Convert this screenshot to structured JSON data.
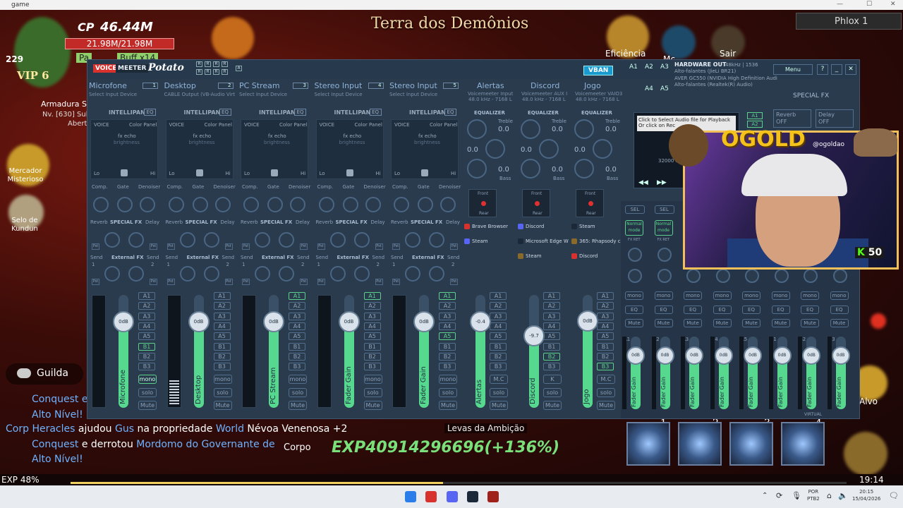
{
  "window": {
    "title": "game"
  },
  "game": {
    "level": "229",
    "vip": "VIP 6",
    "cp_label": "CP",
    "cp_value": "46.44M",
    "hp": "21.98M/21.98M",
    "pa": "Pa",
    "buff": "Buff x14",
    "armor_title": "Armadura Sa",
    "armor_sub": "Nv. [630] Sub",
    "armor_sub2": "Abert",
    "zone_title": "Terra dos Demônios",
    "top_buttons": [
      "Eficiência",
      "Mc",
      "Sair"
    ],
    "player_name": "Phlox 1",
    "left_menu": [
      "Mercador Misterioso",
      "Selo de Kundun"
    ],
    "guild_label": "Guilda",
    "chat_lines": [
      {
        "parts": [
          "Conquest e"
        ]
      },
      {
        "parts": [
          "Alto Nível!"
        ]
      },
      {
        "parts": [
          "Corp",
          "Heracles",
          "ajudou",
          "Gus",
          "na propriedade",
          "World",
          "Névoa Venenosa",
          "+2"
        ]
      },
      {
        "parts": [
          "Conquest",
          "e derrotou",
          "Mordomo do Governante de"
        ]
      },
      {
        "parts": [
          "Alto Nível!"
        ]
      }
    ],
    "corpo_label": "Corpo",
    "exp_big": "EXP40914296696(+136%)",
    "quest_text": "Levas da Ambição",
    "exp_percent": "EXP 48%",
    "clock": "19:14",
    "skill_numbers": [
      "1",
      "2",
      "3",
      "4"
    ],
    "alvo_label": "Alvo"
  },
  "voicemeeter": {
    "logo_voice": "VOICE",
    "logo_meeter": "MEETER",
    "logo_potato": "Potato",
    "vban_label": "VBAN",
    "hardware_out": {
      "title": "HARDWARE OUT",
      "spec": "48kHz | 1536",
      "devices": [
        "Alto-falantes (JieLi BR21)",
        "AVER GC550 (NVIDIA High Definition Audi",
        "Alto-falantes (Realtek(R) Audio)"
      ]
    },
    "a_buttons": [
      "A1",
      "A2",
      "A3",
      "A4",
      "A5"
    ],
    "menu_label": "Menu",
    "special_fx": "SPECIAL FX",
    "reverb_btn": [
      "Reverb",
      "OFF"
    ],
    "delay_btn": [
      "Delay",
      "OFF"
    ],
    "player_text": [
      "Click to Select Audio file for Playback",
      "Or click on Rec"
    ],
    "player_freq": "32000 Hz",
    "hardware_strips": [
      {
        "name": "Microfone",
        "sub": "Select Input Device",
        "num": "1",
        "fader_label": "Microfone",
        "fader_value": "0dB",
        "buses_on": [
          "B1"
        ],
        "mono_on": true
      },
      {
        "name": "Desktop",
        "sub": "CABLE Output (VB-Audio Virt",
        "num": "2",
        "fader_label": "Desktop",
        "fader_value": "0dB",
        "buses_on": [],
        "mono_on": false
      },
      {
        "name": "PC Stream",
        "sub": "Select Input Device",
        "num": "3",
        "fader_label": "PC Stream",
        "fader_value": "0dB",
        "buses_on": [
          "A1"
        ],
        "mono_on": false
      },
      {
        "name": "Stereo Input",
        "sub": "Select Input Device",
        "num": "4",
        "fader_label": "Fader Gain",
        "fader_value": "0dB",
        "buses_on": [
          "A1"
        ],
        "mono_on": false
      },
      {
        "name": "Stereo Input",
        "sub": "Select Input Device",
        "num": "5",
        "fader_label": "Fader Gain",
        "fader_value": "0dB",
        "buses_on": [
          "A1",
          "A5"
        ],
        "mono_on": false
      }
    ],
    "strip_labels": {
      "intellipan": "INTELLIPAN",
      "eq": "EQ",
      "voice": "VOICE",
      "color_panel": "Color Panel",
      "fx_echo": "fx echo",
      "brightness": "brightness",
      "lo": "Lo",
      "hi": "Hi",
      "comp": "Comp.",
      "gate": "Gate",
      "denoiser": "Denoiser",
      "reverb": "Reverb",
      "special_fx": "SPECIAL FX",
      "delay": "Delay",
      "send": "Send",
      "external_fx": "External FX",
      "send1": "1",
      "send2": "2",
      "pst": "Pst",
      "mono": "mono",
      "solo": "solo",
      "mute": "Mute",
      "bus_list": [
        "A1",
        "A2",
        "A3",
        "A4",
        "A5",
        "B1",
        "B2",
        "B3"
      ]
    },
    "virtual_strips": [
      {
        "name": "Alertas",
        "sub1": "Voicemeeter Input",
        "sub2": "48.0 kHz - 7168 L",
        "treble": "0.0",
        "mid": "0.0",
        "bass": "0.0",
        "fader_label": "Alertas",
        "fader_value": "-0.4",
        "apps": [
          "Brave Browser",
          "Steam"
        ],
        "buses_on": [],
        "level": -0.4
      },
      {
        "name": "Discord",
        "sub1": "Voicemeeter AUX I",
        "sub2": "48.0 kHz - 7168 L",
        "treble": "0.0",
        "mid": "0.0",
        "bass": "0.0",
        "fader_label": "Discord",
        "fader_value": "-9.7",
        "apps": [
          "Discord",
          "Microsoft Edge W",
          "Steam"
        ],
        "buses_on": [
          "B2"
        ],
        "level": -9.7
      },
      {
        "name": "Jogo",
        "sub1": "Voicemeeter VAIO3",
        "sub2": "48.0 kHz - 7168 L",
        "treble": "0.0",
        "mid": "0.0",
        "bass": "0.0",
        "fader_label": "Jogo",
        "fader_value": "0dB",
        "apps": [
          "Steam",
          "365: Rhapsody c",
          "Discord"
        ],
        "buses_on": [
          "B3"
        ],
        "level": 0
      }
    ],
    "virtual_labels": {
      "equalizer": "EQUALIZER",
      "treble": "Treble",
      "bass": "Bass",
      "front": "Front",
      "rear": "Rear",
      "mc": "M.C",
      "k": "K"
    },
    "output_buses": [
      {
        "name": "A1",
        "value": "0dB"
      },
      {
        "name": "A2",
        "value": "0dB"
      },
      {
        "name": "A3",
        "value": "0dB"
      },
      {
        "name": "A4",
        "value": "0dB"
      },
      {
        "name": "A5",
        "value": "0dB"
      },
      {
        "name": "B1",
        "value": "0dB"
      },
      {
        "name": "B2",
        "value": "0dB"
      },
      {
        "name": "B3",
        "value": "0dB"
      }
    ],
    "output_labels": {
      "sel": "SEL",
      "normal_mode": "Normal mode",
      "fx_ret": "FX RET",
      "mono": "mono",
      "eq": "EQ",
      "mute": "Mute",
      "fader": "Fader Gain",
      "virtual": "VIRTUAL"
    }
  },
  "stream": {
    "brand": "OGOLD",
    "handle": "@ogoldao",
    "kick_count": "50",
    "kick_letter": "K"
  },
  "taskbar": {
    "lang1": "POR",
    "lang2": "PTB2",
    "time": "20:15",
    "date": "15/04/2026"
  },
  "colors": {
    "accent_green": "#5bd18b",
    "vm_bg": "#2a3b4e",
    "logo_red": "#d8322e",
    "gold": "#f4c21b"
  }
}
